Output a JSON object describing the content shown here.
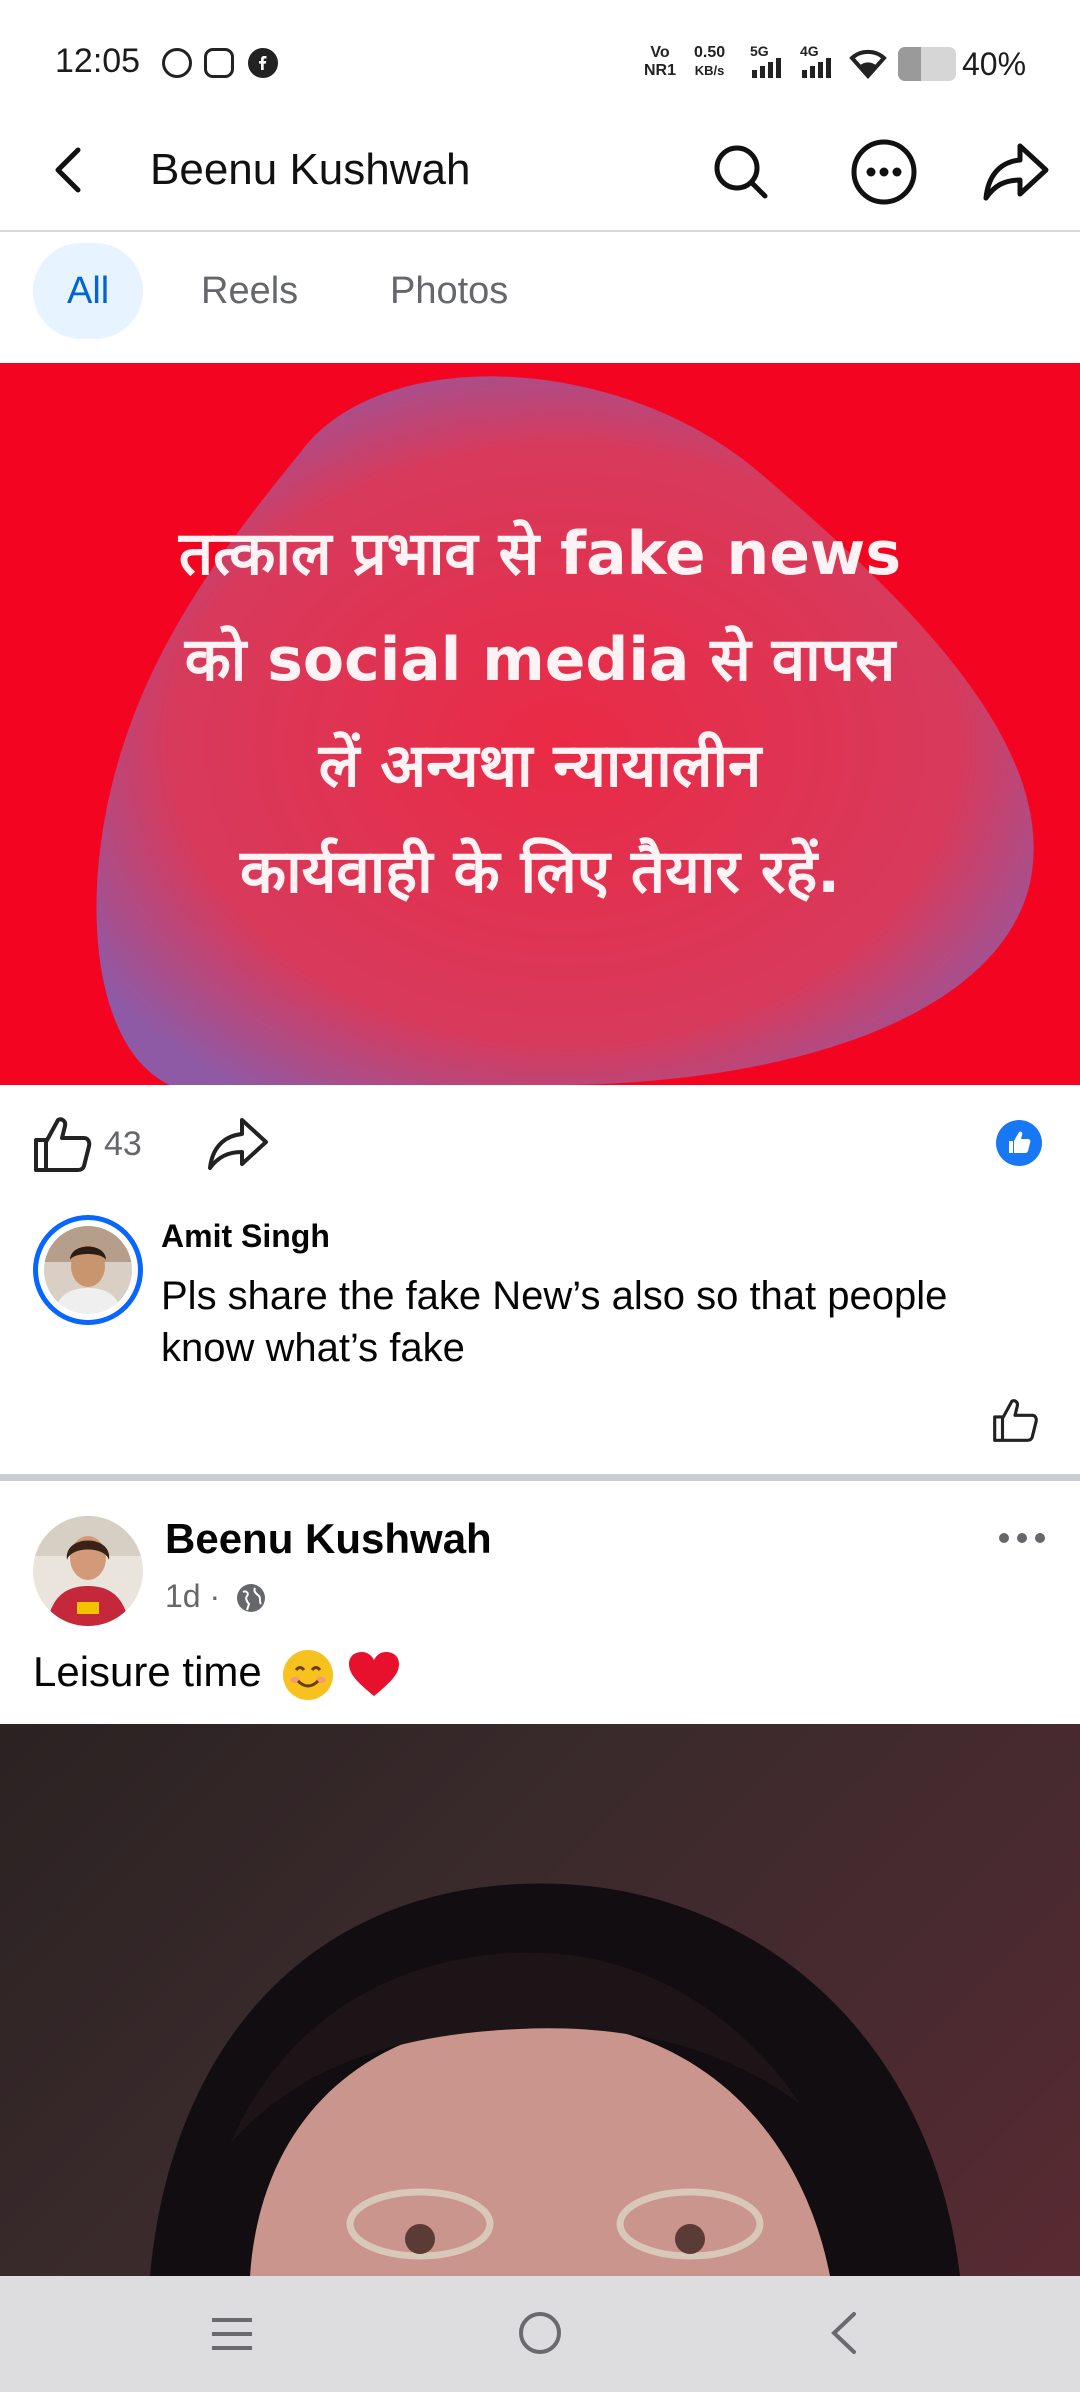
{
  "status_bar": {
    "time": "12:05",
    "app_icons": [
      "whatsapp-icon",
      "camera-icon",
      "facebook-icon"
    ],
    "volte": "Vo",
    "volte_sub": "NR1",
    "speed_value": "0.50",
    "speed_unit": "KB/s",
    "net1": "5G",
    "net2": "4G",
    "battery_percent": "40%",
    "battery_level": 0.4
  },
  "header": {
    "title": "Beenu Kushwah",
    "icons": [
      "back-icon",
      "search-icon",
      "more-icon",
      "share-icon"
    ]
  },
  "tabs": [
    {
      "label": "All",
      "active": true
    },
    {
      "label": "Reels",
      "active": false
    },
    {
      "label": "Photos",
      "active": false
    }
  ],
  "post1": {
    "image_text_lines": [
      "तत्काल प्रभाव से fake news",
      "को social media से वापस",
      "लें अन्यथा न्यायालीन",
      "कार्यवाही के लिए तैयार रहें."
    ],
    "image_bg_color": "#f30521",
    "like_count": "43",
    "comment": {
      "author": "Amit Singh",
      "text": "Pls share the fake New’s also so that people know what’s fake"
    }
  },
  "post2": {
    "author": "Beenu Kushwah",
    "time": "1d ·",
    "caption": "Leisure time"
  },
  "colors": {
    "accent": "#0866ff",
    "tab_active_bg": "#e7f3ff",
    "tab_active_text": "#0064d1",
    "secondary_text": "#65676b"
  }
}
